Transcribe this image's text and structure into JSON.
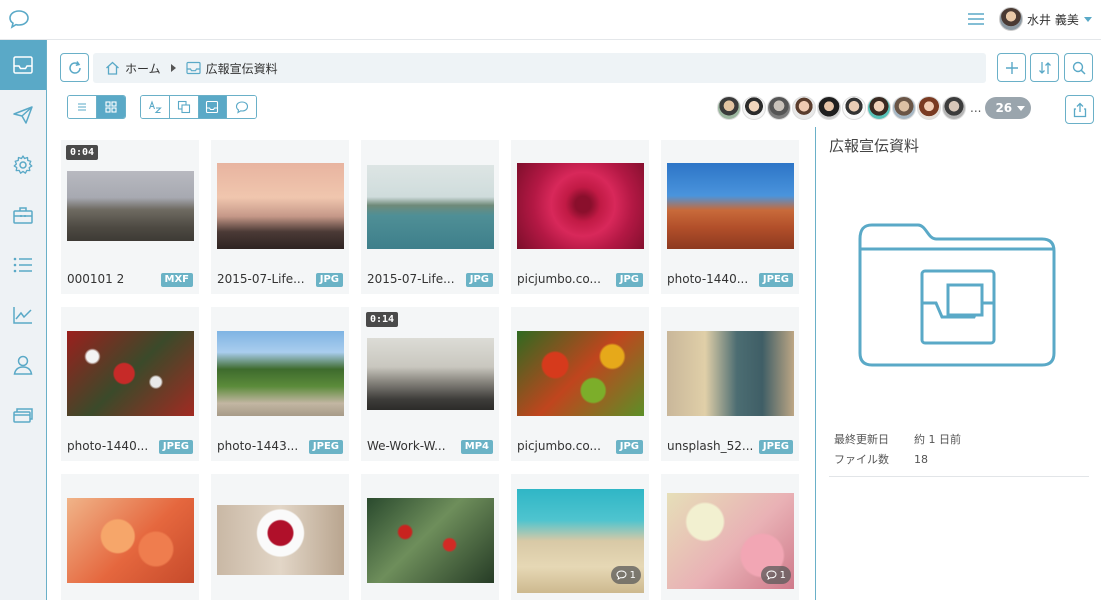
{
  "header": {
    "user_name": "水井 義美"
  },
  "sidebar": {
    "items": [
      {
        "name": "inbox-icon",
        "active": true
      },
      {
        "name": "send-icon",
        "active": false
      },
      {
        "name": "gear-icon",
        "active": false
      },
      {
        "name": "toolbox-icon",
        "active": false
      },
      {
        "name": "list-icon",
        "active": false
      },
      {
        "name": "chart-icon",
        "active": false
      },
      {
        "name": "user-icon",
        "active": false
      },
      {
        "name": "cards-icon",
        "active": false
      }
    ]
  },
  "breadcrumb": {
    "home": "ホーム",
    "current": "広報宣伝資料"
  },
  "members": {
    "more": "...",
    "count": "26"
  },
  "files": [
    {
      "name": "000101 2",
      "ext": "MXF",
      "duration": "0:04",
      "comments": ""
    },
    {
      "name": "2015-07-Life...",
      "ext": "JPG",
      "duration": "",
      "comments": ""
    },
    {
      "name": "2015-07-Life...",
      "ext": "JPG",
      "duration": "",
      "comments": ""
    },
    {
      "name": "picjumbo.co...",
      "ext": "JPG",
      "duration": "",
      "comments": ""
    },
    {
      "name": "photo-1440...",
      "ext": "JPEG",
      "duration": "",
      "comments": ""
    },
    {
      "name": "photo-1440...",
      "ext": "JPEG",
      "duration": "",
      "comments": ""
    },
    {
      "name": "photo-1443...",
      "ext": "JPEG",
      "duration": "",
      "comments": ""
    },
    {
      "name": "We-Work-W...",
      "ext": "MP4",
      "duration": "0:14",
      "comments": ""
    },
    {
      "name": "picjumbo.co...",
      "ext": "JPG",
      "duration": "",
      "comments": ""
    },
    {
      "name": "unsplash_52...",
      "ext": "JPEG",
      "duration": "",
      "comments": ""
    },
    {
      "name": "",
      "ext": "",
      "duration": "",
      "comments": ""
    },
    {
      "name": "",
      "ext": "",
      "duration": "",
      "comments": ""
    },
    {
      "name": "",
      "ext": "",
      "duration": "",
      "comments": ""
    },
    {
      "name": "",
      "ext": "",
      "duration": "",
      "comments": "1"
    },
    {
      "name": "",
      "ext": "",
      "duration": "",
      "comments": "1"
    }
  ],
  "panel": {
    "title": "広報宣伝資料",
    "updated_label": "最終更新日",
    "updated_value": "約 1 日前",
    "count_label": "ファイル数",
    "count_value": "18"
  },
  "colors": {
    "accent": "#5aa9c7",
    "badge": "#6bb3c6"
  }
}
